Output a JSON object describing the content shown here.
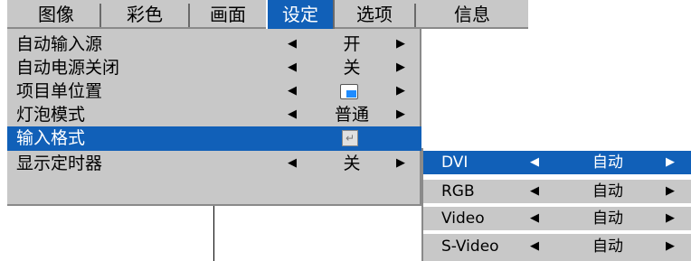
{
  "tabs": [
    {
      "label": "图像"
    },
    {
      "label": "彩色"
    },
    {
      "label": "画面"
    },
    {
      "label": "设定",
      "active": true
    },
    {
      "label": "选项"
    },
    {
      "label": "信息"
    }
  ],
  "menu": [
    {
      "label": "自动输入源",
      "value": "开"
    },
    {
      "label": "自动电源关闭",
      "value": "关"
    },
    {
      "label": "项目单位置",
      "value_icon": "position-icon"
    },
    {
      "label": "灯泡模式",
      "value": "普通"
    },
    {
      "label": "输入格式",
      "value_icon": "enter-icon",
      "selected": true
    },
    {
      "label": "显示定时器",
      "value": "关"
    }
  ],
  "submenu": [
    {
      "label": "DVI",
      "value": "自动",
      "selected": true
    },
    {
      "label": "RGB",
      "value": "自动"
    },
    {
      "label": "Video",
      "value": "自动"
    },
    {
      "label": "S-Video",
      "value": "自动"
    }
  ],
  "arrows": {
    "left": "◀",
    "right": "▶",
    "enter": "↵"
  },
  "colors": {
    "highlight": "#1160b8",
    "panel": "#c8c8c8"
  }
}
